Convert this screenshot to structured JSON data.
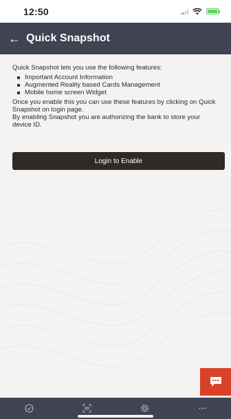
{
  "status_bar": {
    "time": "12:50"
  },
  "header": {
    "title": "Quick Snapshot",
    "back_icon": "back-arrow-icon"
  },
  "content": {
    "intro": "Quick Snapshot lets you use the following features:",
    "features": [
      "Important Account Information",
      "Augmented Reality based Cards Management",
      "Mobile home screen Widget"
    ],
    "enable_note": "Once you enable this you can use these features by clicking on Quick Snapshot on login page.",
    "authorize_note": "By enabling Snapshot you are authorizing the bank to store your device ID."
  },
  "login_button": {
    "label": "Login to Enable"
  },
  "chat": {
    "icon": "chat-icon",
    "color": "#d94226"
  },
  "bottom_nav": {
    "items": [
      {
        "icon": "check-circle-icon"
      },
      {
        "icon": "scan-icon"
      },
      {
        "icon": "gear-icon"
      },
      {
        "icon": "more-icon"
      }
    ]
  },
  "colors": {
    "header": "#3f4352",
    "button": "#2e2a28",
    "accent": "#d94226"
  }
}
